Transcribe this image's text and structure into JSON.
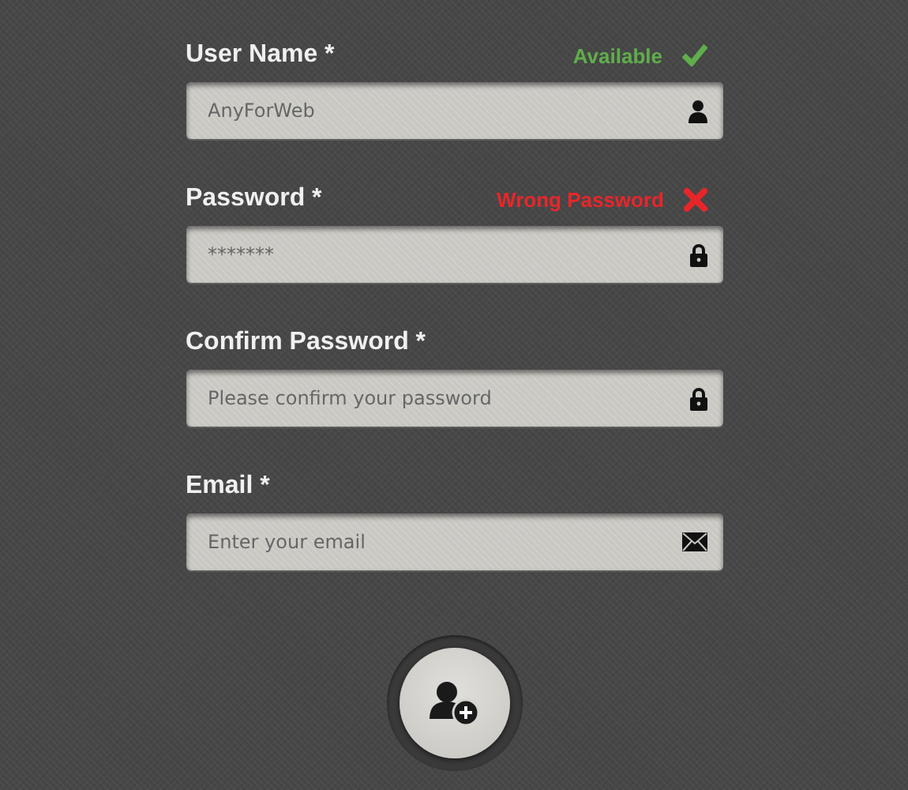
{
  "fields": [
    {
      "label": "User Name *",
      "kind": "text",
      "value": "AnyForWeb",
      "status": {
        "kind": "ok",
        "text": "Available"
      }
    },
    {
      "label": "Password *",
      "kind": "password",
      "value": "*******",
      "status": {
        "kind": "error",
        "text": "Wrong Password"
      }
    },
    {
      "label": "Confirm Password *",
      "kind": "password",
      "placeholder": "Please confirm your password"
    },
    {
      "label": "Email *",
      "kind": "email",
      "placeholder": "Enter your email"
    }
  ]
}
